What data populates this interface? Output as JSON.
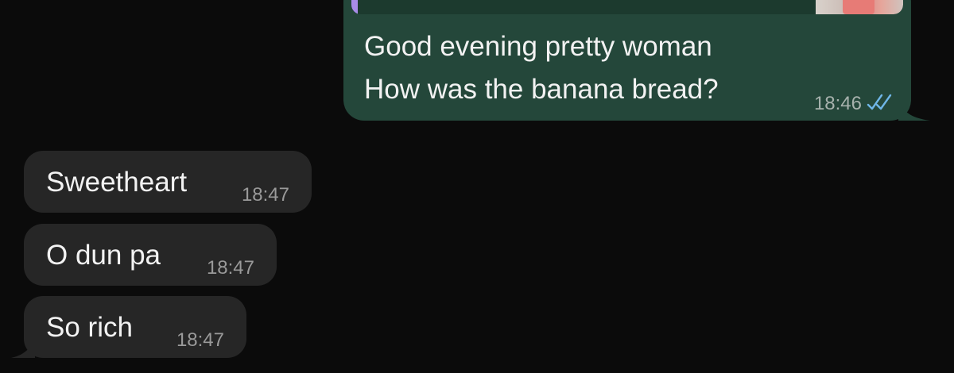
{
  "chat": {
    "outgoing": {
      "lines": [
        "Good evening pretty woman",
        "How was the banana bread?"
      ],
      "time": "18:46",
      "status_icon": "double-check-read-icon",
      "quote_accent_color": "#a98ce8"
    },
    "incoming": [
      {
        "text": "Sweetheart",
        "time": "18:47"
      },
      {
        "text": "O dun pa",
        "time": "18:47"
      },
      {
        "text": "So rich",
        "time": "18:47"
      }
    ]
  },
  "colors": {
    "background": "#0b0b0b",
    "outgoing_bubble": "#24473a",
    "incoming_bubble": "#262626",
    "read_tick": "#6fb6e8"
  }
}
